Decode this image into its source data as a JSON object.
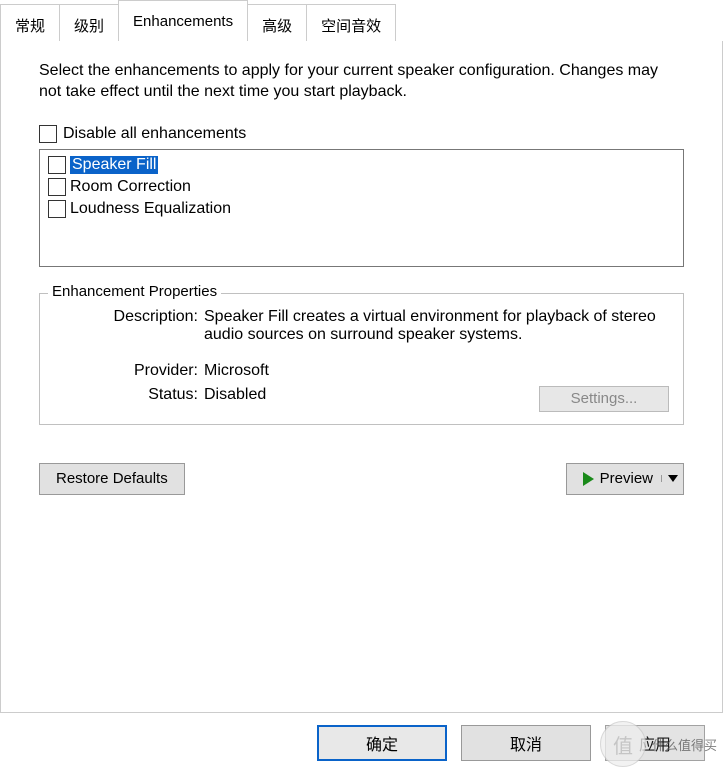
{
  "tabs": {
    "general": "常规",
    "levels": "级别",
    "enhancements": "Enhancements",
    "advanced": "高级",
    "spatial": "空间音效",
    "active": "enhancements"
  },
  "hint": "Select the enhancements to apply for your current speaker configuration. Changes may not take effect until the next time you start playback.",
  "disable_all_label": "Disable all enhancements",
  "enhancements": [
    {
      "label": "Speaker Fill",
      "selected": true
    },
    {
      "label": "Room Correction",
      "selected": false
    },
    {
      "label": "Loudness Equalization",
      "selected": false
    }
  ],
  "properties": {
    "group_title": "Enhancement Properties",
    "description_key": "Description:",
    "description_val": "Speaker Fill creates a virtual environment for playback of stereo audio sources on surround speaker systems.",
    "provider_key": "Provider:",
    "provider_val": "Microsoft",
    "status_key": "Status:",
    "status_val": "Disabled",
    "settings_btn": "Settings..."
  },
  "restore_defaults": "Restore Defaults",
  "preview": "Preview",
  "dialog": {
    "ok": "确定",
    "cancel": "取消",
    "apply": "应用"
  },
  "watermark": {
    "char": "值",
    "text": "什么值得买"
  }
}
